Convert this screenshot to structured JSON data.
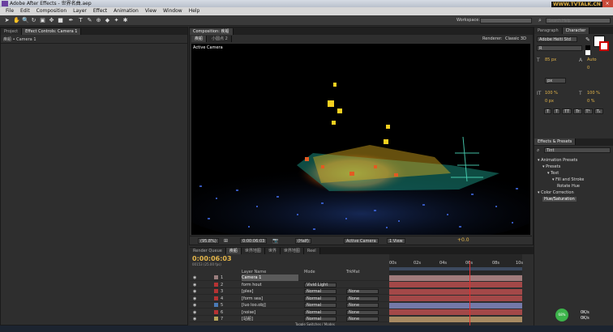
{
  "window": {
    "title": "Adobe After Effects - 世界名曲.aep",
    "controls": [
      "–",
      "▫",
      "×"
    ]
  },
  "menu": [
    "File",
    "Edit",
    "Composition",
    "Layer",
    "Effect",
    "Animation",
    "View",
    "Window",
    "Help"
  ],
  "toolbar": {
    "workspace_label": "Workspace:",
    "workspace_value": "",
    "search_placeholder": "Search Help",
    "icons": [
      "selection-tool-icon",
      "hand-tool-icon",
      "zoom-tool-icon",
      "rotate-tool-icon",
      "camera-tool-icon",
      "pan-behind-icon",
      "rectangle-tool-icon",
      "pen-tool-icon",
      "type-tool-icon",
      "brush-tool-icon",
      "clone-tool-icon",
      "eraser-tool-icon",
      "roto-brush-icon",
      "puppet-tool-icon"
    ]
  },
  "watermark": "WWW.TVTALK.CN",
  "left_panel": {
    "tabs": [
      "Project",
      "Effect Controls: Camera 1"
    ],
    "breadcrumb": "疾船 • Camera 1"
  },
  "comp": {
    "tabs": [
      "Composition: 疾船"
    ],
    "subtabs": [
      "疾船",
      "小圆点 2"
    ],
    "renderer_label": "Renderer:",
    "renderer_value": "Classic 3D",
    "view_label": "Active Camera"
  },
  "viewer_bar": {
    "zoom": "(95.8%)",
    "timecode": "0:00:06:03",
    "resolution": "(Half)",
    "camera": "Active Camera",
    "views": "1 View",
    "exposure": "+0.0"
  },
  "timeline": {
    "tabs": [
      "Render Queue",
      "疾船",
      "世界地图",
      "世界",
      "世界地图",
      "Reel"
    ],
    "timecode": "0:00:06:03",
    "fps": "00153 (25.00 fps)",
    "headers": {
      "name": "Layer Name",
      "mode": "Mode",
      "trkmat": "TrkMat"
    },
    "ruler": [
      "00s",
      "02s",
      "04s",
      "06s",
      "08s",
      "10s"
    ],
    "layers": [
      {
        "num": "1",
        "name": "Camera 1",
        "mode": "",
        "trk": "",
        "color": "#9a7e7e",
        "barcolor": "#a17b7b"
      },
      {
        "num": "2",
        "name": "form hout",
        "mode": "Vivid Light",
        "trk": "",
        "color": "#b63333",
        "barcolor": "#a34848"
      },
      {
        "num": "3",
        "name": "[plex]",
        "mode": "Normal",
        "trk": "None",
        "color": "#b63333",
        "barcolor": "#a34848"
      },
      {
        "num": "4",
        "name": "[form sea]",
        "mode": "Normal",
        "trk": "None",
        "color": "#b63333",
        "barcolor": "#a34848"
      },
      {
        "num": "5",
        "name": "[luo loo.obj]",
        "mode": "Normal",
        "trk": "None",
        "color": "#4a7ab5",
        "barcolor": "#7479a8"
      },
      {
        "num": "6",
        "name": "[noise]",
        "mode": "Normal",
        "trk": "None",
        "color": "#b63333",
        "barcolor": "#a34848"
      },
      {
        "num": "7",
        "name": "[站船]",
        "mode": "Normal",
        "trk": "None",
        "color": "#b6a65a",
        "barcolor": "#a78a62"
      }
    ],
    "footer": "Toggle Switches / Modes"
  },
  "paragraph_panel": {
    "tabs": [
      "Paragraph",
      "Character"
    ],
    "font": "Adobe Heiti Std",
    "style": "R",
    "size": "85 px",
    "leading": "Auto",
    "tracking": "0",
    "unit": "px",
    "scale_v": "100 %",
    "scale_h": "100 %",
    "baseline": "0 px",
    "tsume": "0 %",
    "style_buttons": [
      "T",
      "T",
      "TT",
      "Tr",
      "T¹",
      "T₁"
    ]
  },
  "effects_panel": {
    "title": "Effects & Presets",
    "search": "Tint",
    "tree": [
      "▾ Animation Presets",
      "▾ Presets",
      "▾ Text",
      "▾ Fill and Stroke",
      "Rotate Hue",
      "▾ Color Correction",
      "Hue/Saturation"
    ]
  },
  "net_meter": {
    "percent": "68%",
    "down": "0K/s",
    "up": "0K/s"
  }
}
